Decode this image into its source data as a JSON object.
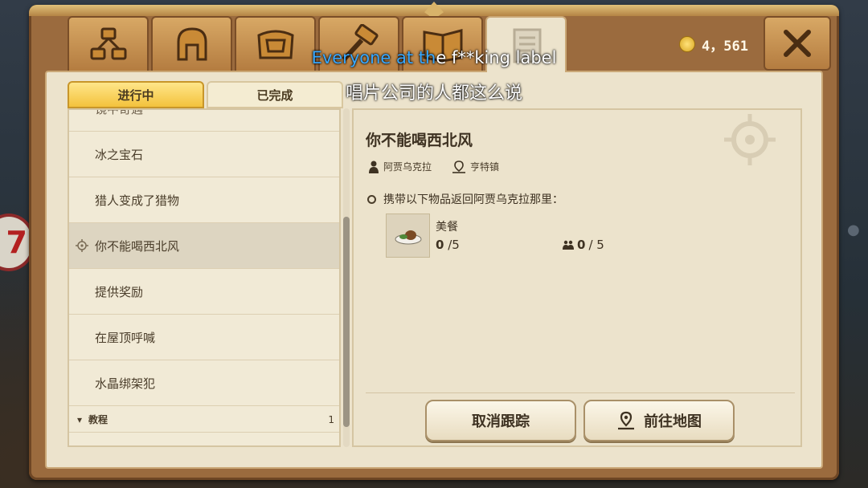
{
  "header": {
    "tabs": [
      {
        "icon": "guild-icon"
      },
      {
        "icon": "helmet-icon"
      },
      {
        "icon": "chest-icon"
      },
      {
        "icon": "hammer-icon"
      },
      {
        "icon": "book-icon"
      },
      {
        "icon": "scroll-icon",
        "active": true
      }
    ],
    "coins": "4，561",
    "close_icon": "close-icon"
  },
  "subtitle": {
    "line1_highlight": "Everyone at th",
    "line1_rest": "e f**king label",
    "line2": "唱片公司的人都这么说"
  },
  "subtabs": {
    "in_progress": "进行中",
    "completed": "已完成"
  },
  "quests": {
    "items": [
      {
        "label": "镜中奇遇"
      },
      {
        "label": "冰之宝石"
      },
      {
        "label": "猎人变成了猎物"
      },
      {
        "label": "你不能喝西北风",
        "selected": true
      },
      {
        "label": "提供奖励"
      },
      {
        "label": "在屋顶呼喊"
      },
      {
        "label": "水晶绑架犯"
      }
    ],
    "group": {
      "label": "教程",
      "count": "1"
    }
  },
  "detail": {
    "title": "你不能喝西北风",
    "npc": "阿贾乌克拉",
    "location": "亨特镇",
    "objective": "携带以下物品返回阿贾乌克拉那里：",
    "item": {
      "name": "美餐",
      "current": "0",
      "total": "/5",
      "party_current": "0",
      "party_total": "/ 5"
    },
    "buttons": {
      "cancel": "取消跟踪",
      "map": "前往地图"
    }
  },
  "colors": {
    "frame": "#9b6b3e",
    "parchment": "#ece3cc",
    "active_tab": "#f3c23c",
    "subtitle_highlight": "#38a8ff"
  }
}
